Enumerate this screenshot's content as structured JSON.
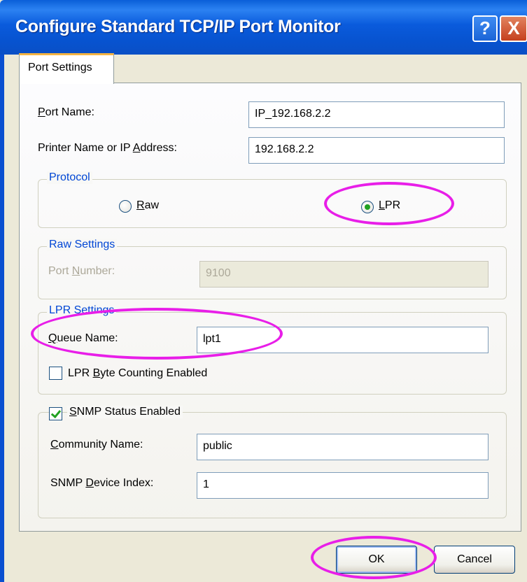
{
  "window": {
    "title": "Configure Standard TCP/IP Port Monitor",
    "help_glyph": "?",
    "close_glyph": "X"
  },
  "tabs": [
    {
      "label": "Port Settings",
      "active": true
    }
  ],
  "port_name": {
    "label": "Port Name:",
    "value": "IP_192.168.2.2"
  },
  "printer_name": {
    "label": "Printer Name or IP Address:",
    "value": "192.168.2.2"
  },
  "protocol": {
    "legend": "Protocol",
    "options": [
      {
        "label": "Raw",
        "selected": false
      },
      {
        "label": "LPR",
        "selected": true
      }
    ]
  },
  "raw_settings": {
    "legend": "Raw Settings",
    "port_number_label": "Port Number:",
    "port_number_value": "9100",
    "enabled": false
  },
  "lpr_settings": {
    "legend": "LPR Settings",
    "queue_name_label": "Queue Name:",
    "queue_name_value": "lpt1",
    "byte_counting_label": "LPR Byte Counting Enabled",
    "byte_counting_checked": false
  },
  "snmp": {
    "enabled_label": "SNMP Status Enabled",
    "enabled_checked": true,
    "community_label": "Community Name:",
    "community_value": "public",
    "device_index_label": "SNMP Device Index:",
    "device_index_value": "1"
  },
  "buttons": {
    "ok": "OK",
    "cancel": "Cancel"
  },
  "colors": {
    "highlight_ring": "#e81ee8",
    "titlebar": "#0a5bdc",
    "group_legend": "#0046d5"
  }
}
